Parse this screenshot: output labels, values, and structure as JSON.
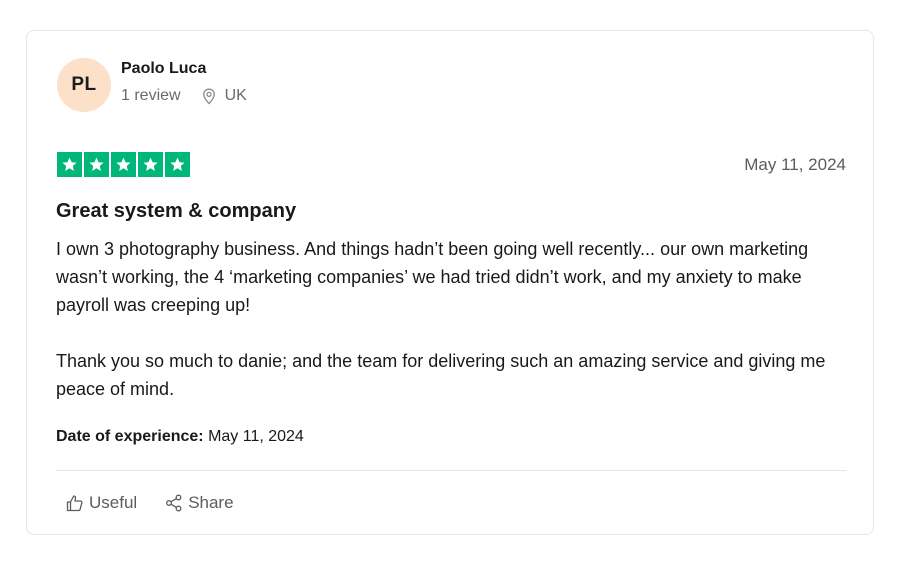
{
  "reviewer": {
    "initials": "PL",
    "name": "Paolo Luca",
    "review_count": "1 review",
    "country": "UK",
    "avatar_color": "#fde0c8"
  },
  "rating": {
    "stars": 5,
    "max": 5,
    "color": "#00b67a"
  },
  "review": {
    "date": "May 11, 2024",
    "title": "Great system & company",
    "paragraphs": [
      "I own 3 photography business. And things hadn’t been going well recently... our own marketing wasn’t working, the 4 ‘marketing companies’ we had tried didn’t work, and my anxiety to make payroll was creeping up!",
      "Thank you so much to danie; and the team for delivering such an amazing service and giving me peace of mind."
    ],
    "experience_label": "Date of experience:",
    "experience_date": "May 11, 2024"
  },
  "actions": {
    "useful_label": "Useful",
    "share_label": "Share"
  },
  "icons": {
    "location": "location-pin-icon",
    "star": "star-icon",
    "useful": "thumbs-up-icon",
    "share": "share-icon"
  }
}
